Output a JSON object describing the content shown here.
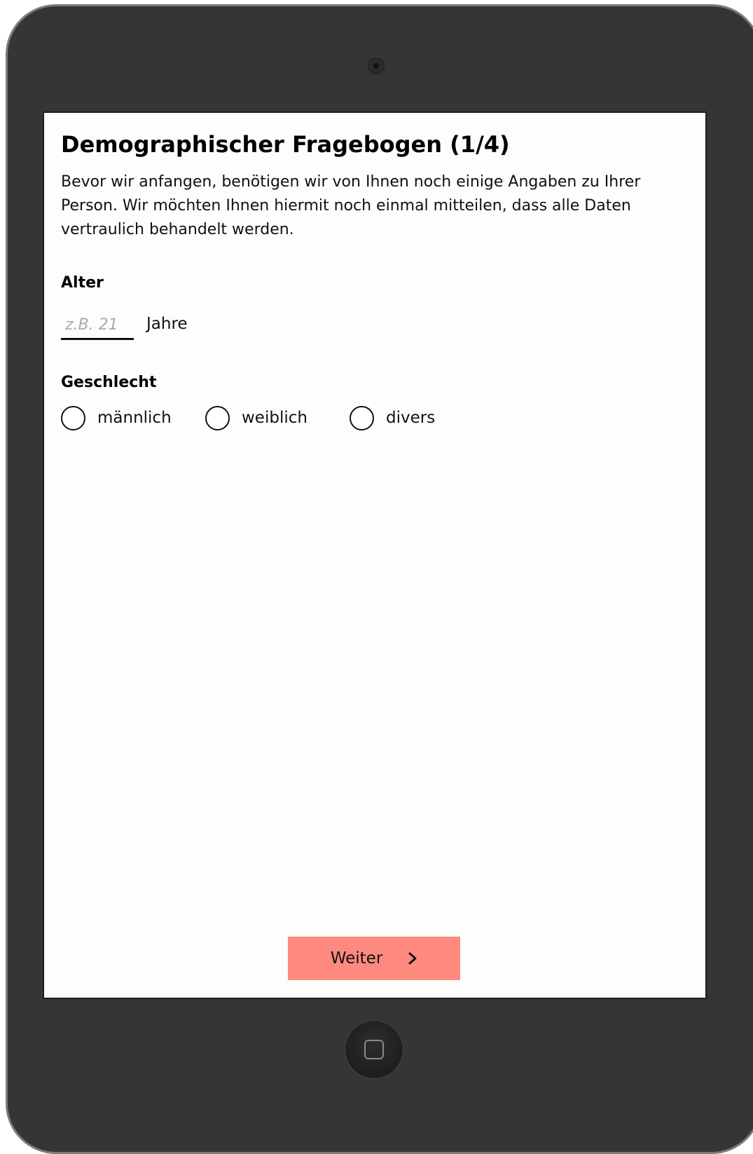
{
  "form": {
    "title": "Demographischer Fragebogen (1/4)",
    "intro": "Bevor wir anfangen, benötigen wir von Ihnen noch einige Angaben zu Ihrer Person. Wir möchten Ihnen hiermit noch einmal mitteilen, dass alle Daten vertraulich behandelt werden.",
    "age": {
      "label": "Alter",
      "placeholder": "z.B. 21",
      "value": "",
      "unit": "Jahre"
    },
    "gender": {
      "label": "Geschlecht",
      "options": [
        {
          "label": "männlich",
          "selected": false
        },
        {
          "label": "weiblich",
          "selected": false
        },
        {
          "label": "divers",
          "selected": false
        }
      ]
    },
    "next_button": {
      "label": "Weiter",
      "icon": "chevron-right-icon",
      "color": "#fe8a7f"
    }
  },
  "device": {
    "frame_color": "#353535",
    "home_icon": "home-button-icon",
    "camera_icon": "camera-icon"
  }
}
